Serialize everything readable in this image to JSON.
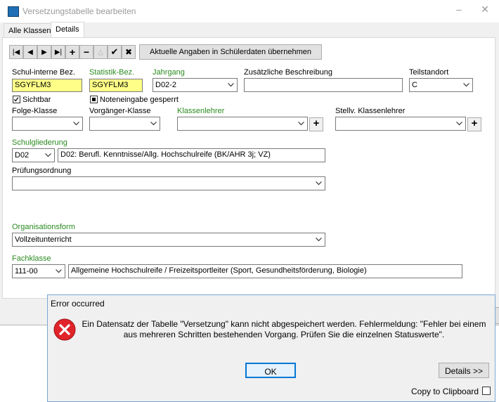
{
  "window": {
    "title": "Versetzungstabelle bearbeiten"
  },
  "tabs": [
    {
      "label": "Alle Klassen"
    },
    {
      "label": "Details"
    }
  ],
  "toolbar": {
    "update_label": "Aktuelle Angaben in Schülerdaten übernehmen"
  },
  "form": {
    "schul_interne_bez": {
      "label": "Schul-interne Bez.",
      "value": "SGYFLM3"
    },
    "statistik_bez": {
      "label": "Statistik-Bez.",
      "value": "SGYFLM3"
    },
    "jahrgang": {
      "label": "Jahrgang",
      "value": "D02-2"
    },
    "zusaetzliche_beschreibung": {
      "label": "Zusätzliche Beschreibung",
      "value": ""
    },
    "teilstandort": {
      "label": "Teilstandort",
      "value": "C"
    },
    "sichtbar": {
      "label": "Sichtbar",
      "checked": true
    },
    "noteneingabe_gesperrt": {
      "label": "Noteneingabe gesperrt",
      "checked": true
    },
    "folge_klasse": {
      "label": "Folge-Klasse",
      "value": ""
    },
    "vorgaenger_klasse": {
      "label": "Vorgänger-Klasse",
      "value": ""
    },
    "klassenlehrer": {
      "label": "Klassenlehrer",
      "value": ""
    },
    "stellv_klassenlehrer": {
      "label": "Stellv. Klassenlehrer",
      "value": ""
    },
    "schulgliederung": {
      "label": "Schulgliederung",
      "code": "D02",
      "description": "D02: Berufl. Kenntnisse/Allg. Hochschulreife (BK/AHR 3j; VZ)"
    },
    "pruefungsordnung": {
      "label": "Prüfungsordnung",
      "value": ""
    },
    "organisationsform": {
      "label": "Organisationsform",
      "value": "Vollzeitunterricht"
    },
    "fachklasse": {
      "label": "Fachklasse",
      "code": "111-00",
      "description": "Allgemeine Hochschulreife / Freizeitsportleiter (Sport, Gesundheitsförderung, Biologie)"
    }
  },
  "dialog": {
    "title": "Error occurred",
    "message_line1": "Ein Datensatz der Tabelle \"Versetzung\" kann nicht abgespeichert werden. Fehlermeldung: \"Fehler bei einem",
    "message_line2": "aus mehreren Schritten bestehenden Vorgang.  Prüfen Sie die einzelnen Statuswerte\".",
    "ok_label": "OK",
    "details_label": "Details >>",
    "clipboard_label": "Copy to Clipboard"
  },
  "colors": {
    "required_label": "#2a8a1f",
    "highlight_field": "#ffff88",
    "error_red": "#e0242a"
  }
}
